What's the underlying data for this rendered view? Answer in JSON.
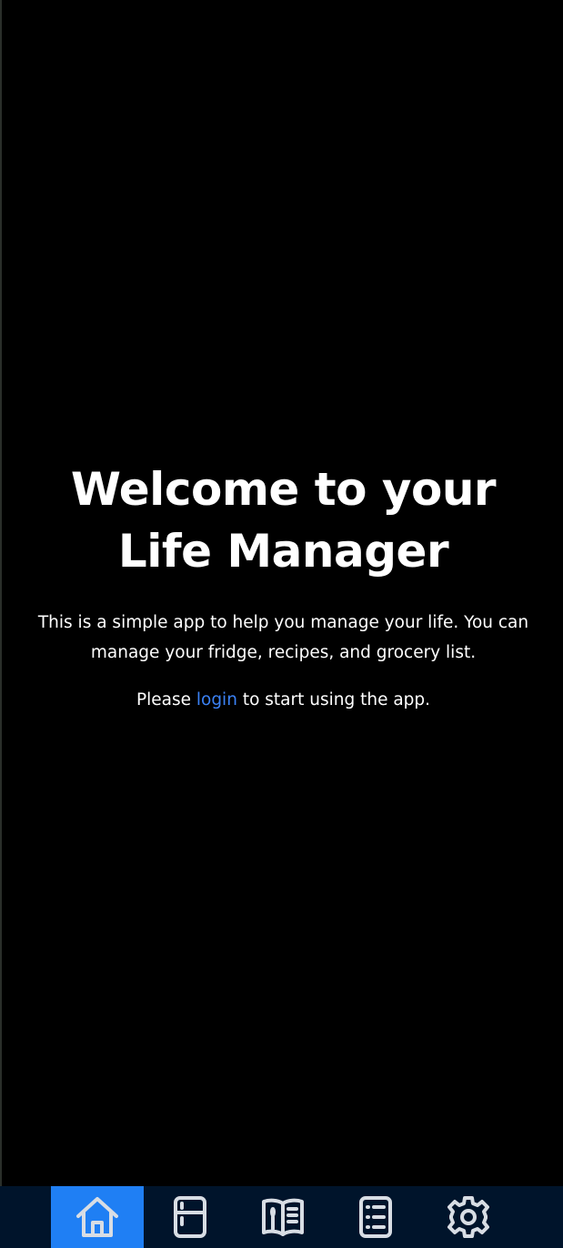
{
  "main": {
    "title": "Welcome to your Life Manager",
    "description": "This is a simple app to help you manage your life. You can manage your fridge, recipes, and grocery list.",
    "cta_before": "Please ",
    "cta_link": "login",
    "cta_after": " to start using the app."
  },
  "nav": {
    "items": [
      {
        "icon": "home-icon",
        "active": true
      },
      {
        "icon": "fridge-icon",
        "active": false
      },
      {
        "icon": "recipe-book-icon",
        "active": false
      },
      {
        "icon": "list-icon",
        "active": false
      },
      {
        "icon": "gear-icon",
        "active": false
      }
    ]
  },
  "colors": {
    "background": "#000000",
    "nav_background": "#00142b",
    "active_tab": "#1f7ff4",
    "link": "#3b82f6",
    "icon": "#d8dde4"
  }
}
